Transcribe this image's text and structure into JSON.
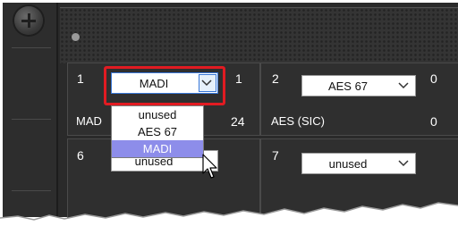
{
  "slots": [
    {
      "number": "1",
      "selected": "MADI",
      "label": "MAD",
      "count": "1",
      "count2": "24"
    },
    {
      "number": "2",
      "selected": "AES 67",
      "label": "AES (SIC)",
      "count": "0",
      "count2": "0"
    },
    {
      "number": "6",
      "selected": "unused"
    },
    {
      "number": "7",
      "selected": "unused"
    }
  ],
  "dropdown": {
    "options": [
      "unused",
      "AES 67",
      "MADI"
    ],
    "highlighted": "MADI"
  },
  "icons": {
    "chevron": "chevron-down-icon",
    "screw": "screw-icon",
    "cursor": "mouse-pointer-icon"
  },
  "colors": {
    "highlight_border": "#e11b22",
    "option_highlight": "#8d8dea",
    "panel": "#2f2f2f"
  }
}
